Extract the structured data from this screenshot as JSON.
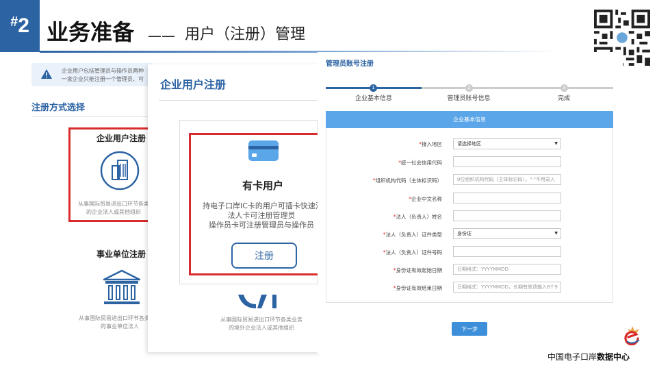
{
  "slide": {
    "number": "2",
    "hash": "#",
    "title_main": "业务准备",
    "title_dash": "——",
    "title_sub": "用户（注册）管理"
  },
  "left": {
    "notice_line1": "企业用户包括管理员与操作员两种",
    "notice_line2": "一家企业只能注册一个管理员、可",
    "method_title": "注册方式选择",
    "enterprise_title": "企业用户注册",
    "enterprise_desc1": "从事国际贸易进出口环节各类",
    "enterprise_desc2": "的企业法人或其他组织",
    "institution_title": "事业单位注册",
    "institution_desc1": "从事国际贸易进出口环节各类业务",
    "institution_desc2": "的事业单位法人"
  },
  "middle": {
    "title": "企业用户注册",
    "card_title": "有卡用户",
    "card_desc1": "持电子口岸IC卡的用户可插卡快速注",
    "card_desc2": "法人卡可注册管理员",
    "card_desc3": "操作员卡可注册管理员与操作员",
    "register_button": "注册",
    "bottom_desc1": "从事国际贸易进出口环节各类业务",
    "bottom_desc2": "的境外企业法人或其他组织"
  },
  "right": {
    "title": "管理员账号注册",
    "steps": [
      {
        "num": "1",
        "label": "企业基本信息"
      },
      {
        "num": "2",
        "label": "管理员账号信息"
      },
      {
        "num": "3",
        "label": "完成"
      }
    ],
    "form_header": "企业基本信息",
    "fields": [
      {
        "label": "接入地区",
        "value": "请选择地区",
        "placeholder": ""
      },
      {
        "label": "统一社会信用代码",
        "value": "",
        "placeholder": ""
      },
      {
        "label": "组织机构代码（主体标识码）",
        "value": "",
        "placeholder": "9位组织机构代码（主体标识码），\"-\"不用录入"
      },
      {
        "label": "企业中文名称",
        "value": "",
        "placeholder": ""
      },
      {
        "label": "法人（负责人）姓名",
        "value": "",
        "placeholder": ""
      },
      {
        "label": "法人（负责人）证件类型",
        "value": "身份证",
        "placeholder": ""
      },
      {
        "label": "法人（负责人）证件号码",
        "value": "",
        "placeholder": ""
      },
      {
        "label": "身份证有效起始日期",
        "value": "",
        "placeholder": "日期格式：YYYYMMDD"
      },
      {
        "label": "身份证有效结束日期",
        "value": "",
        "placeholder": "日期格式：YYYYMMDD，长期有效请输入8个9"
      }
    ],
    "required_mark": "*",
    "next_button": "下一步"
  },
  "footer": {
    "text_normal": "中国电子口岸",
    "text_bold": "数据中心"
  },
  "colors": {
    "brand_blue": "#2c63a3",
    "highlight_red": "#d92b2b",
    "form_header_blue": "#5aa6e8",
    "button_blue": "#3d8fd9"
  }
}
